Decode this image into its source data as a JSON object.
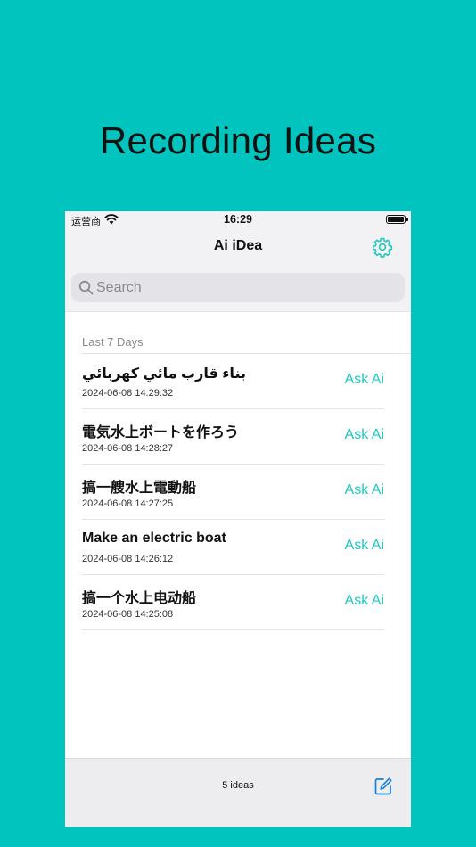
{
  "headline": "Recording Ideas",
  "status_bar": {
    "carrier": "运营商",
    "time": "16:29"
  },
  "nav": {
    "title": "Ai iDea",
    "settings_icon": "gear-icon"
  },
  "search": {
    "placeholder": "Search"
  },
  "section": {
    "header": "Last 7 Days"
  },
  "ideas": [
    {
      "title": "بناء قارب مائي كهربائي",
      "date": "2024-06-08 14:29:32",
      "action": "Ask Ai"
    },
    {
      "title": "電気水上ボートを作ろう",
      "date": "2024-06-08 14:28:27",
      "action": "Ask Ai"
    },
    {
      "title": "搞一艘水上電動船",
      "date": "2024-06-08 14:27:25",
      "action": "Ask Ai"
    },
    {
      "title": "Make an electric boat",
      "date": "2024-06-08 14:26:12",
      "action": "Ask Ai"
    },
    {
      "title": "搞一个水上电动船",
      "date": "2024-06-08 14:25:08",
      "action": "Ask Ai"
    }
  ],
  "toolbar": {
    "count": "5 ideas",
    "compose_icon": "compose-icon"
  },
  "colors": {
    "background": "#00c4bd",
    "accent": "#1ec8c0"
  }
}
